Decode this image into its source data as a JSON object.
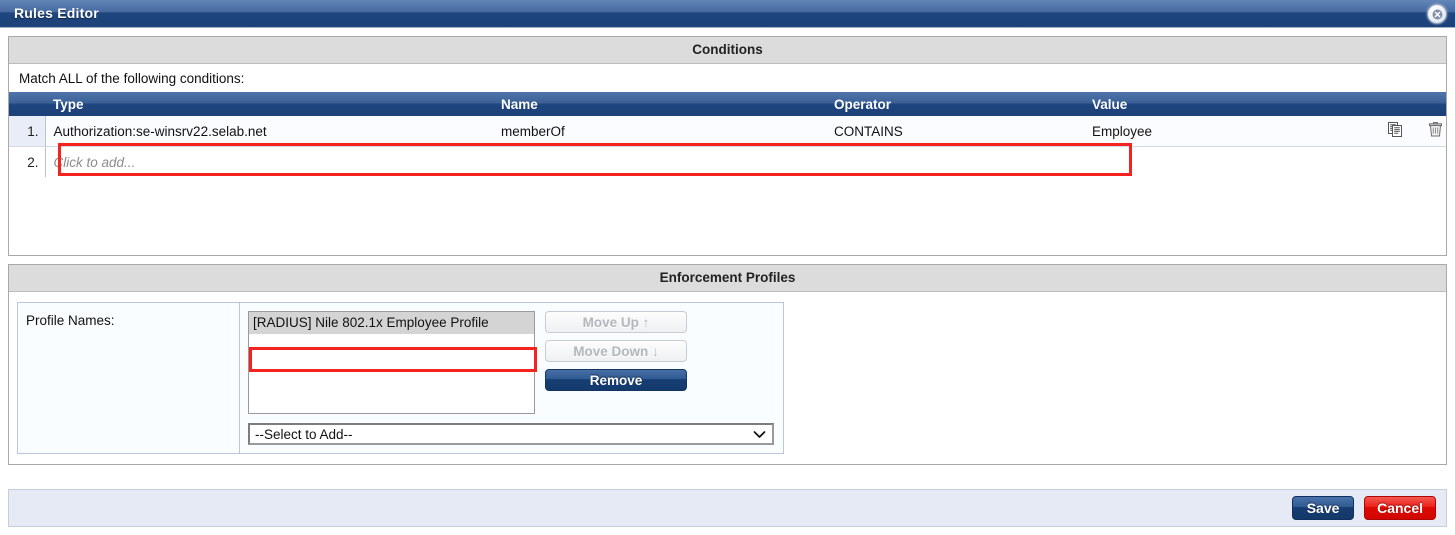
{
  "window": {
    "title": "Rules Editor",
    "close_icon": "close-circle-icon"
  },
  "conditions": {
    "heading": "Conditions",
    "match_label": "Match ALL of the following conditions:",
    "columns": [
      "Type",
      "Name",
      "Operator",
      "Value"
    ],
    "rows": [
      {
        "index": "1.",
        "type": "Authorization:se-winsrv22.selab.net",
        "name": "memberOf",
        "operator": "CONTAINS",
        "value": "Employee",
        "copy_icon": "copy-icon",
        "delete_icon": "trash-icon"
      },
      {
        "index": "2.",
        "placeholder": "Click to add..."
      }
    ]
  },
  "enforcement_profiles": {
    "heading": "Enforcement Profiles",
    "profile_names_label": "Profile Names:",
    "profiles": [
      "[RADIUS] Nile 802.1x Employee Profile"
    ],
    "move_up_label": "Move Up ↑",
    "move_down_label": "Move Down ↓",
    "remove_label": "Remove",
    "select_value": "--Select to Add--",
    "select_chevron_icon": "chevron-down-icon"
  },
  "footer": {
    "save_label": "Save",
    "cancel_label": "Cancel"
  },
  "colors": {
    "accent_blue": "#1f4680",
    "cancel_red": "#ee1f17",
    "highlight_red": "#f4231f"
  }
}
